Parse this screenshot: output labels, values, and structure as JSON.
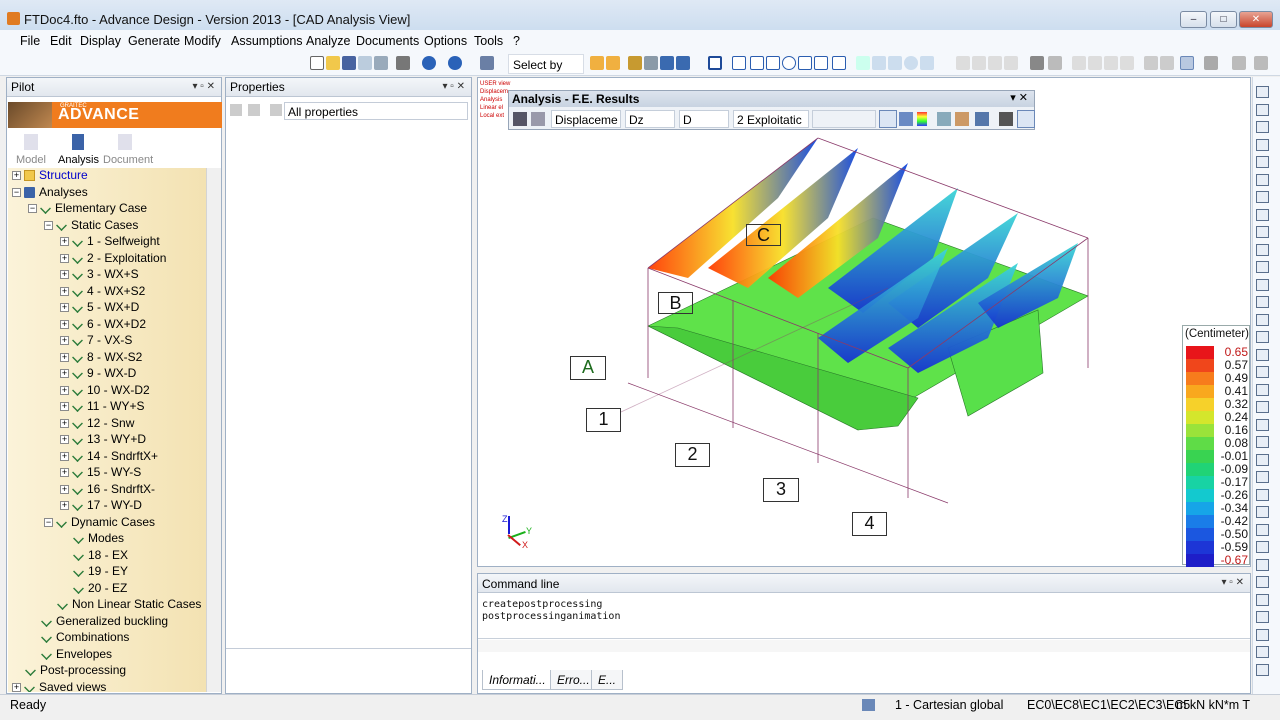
{
  "window": {
    "title": "FTDoc4.fto - Advance Design - Version 2013 - [CAD Analysis View]",
    "minimize": "–",
    "maximize": "□",
    "close": "✕"
  },
  "menu": [
    "File",
    "Edit",
    "Display",
    "Generate",
    "Modify",
    "Assumptions",
    "Analyze",
    "Documents",
    "Options",
    "Tools",
    "?"
  ],
  "toolbar": {
    "select_by": "Select by"
  },
  "pilot": {
    "title": "Pilot",
    "logo_small": "GRAITEC",
    "logo": "ADVANCE",
    "tabs": [
      "Model",
      "Analysis",
      "Document"
    ],
    "active_tab": "Analysis",
    "tree": [
      {
        "label": "Structure",
        "level": 0,
        "exp": "+",
        "icon": "folder",
        "color": "#0000cc"
      },
      {
        "label": "Analyses",
        "level": 0,
        "exp": "−",
        "icon": "book"
      },
      {
        "label": "Elementary Case",
        "level": 1,
        "exp": "−",
        "icon": "check"
      },
      {
        "label": "Static Cases",
        "level": 2,
        "exp": "−",
        "icon": "check"
      },
      {
        "label": "1 - Selfweight",
        "level": 3,
        "exp": "+",
        "icon": "check"
      },
      {
        "label": "2 - Exploitation",
        "level": 3,
        "exp": "+",
        "icon": "check"
      },
      {
        "label": "3 - WX+S",
        "level": 3,
        "exp": "+",
        "icon": "check"
      },
      {
        "label": "4 - WX+S2",
        "level": 3,
        "exp": "+",
        "icon": "check"
      },
      {
        "label": "5 - WX+D",
        "level": 3,
        "exp": "+",
        "icon": "check"
      },
      {
        "label": "6 - WX+D2",
        "level": 3,
        "exp": "+",
        "icon": "check"
      },
      {
        "label": "7 - VX-S",
        "level": 3,
        "exp": "+",
        "icon": "check"
      },
      {
        "label": "8 - WX-S2",
        "level": 3,
        "exp": "+",
        "icon": "check"
      },
      {
        "label": "9 - WX-D",
        "level": 3,
        "exp": "+",
        "icon": "check"
      },
      {
        "label": "10 - WX-D2",
        "level": 3,
        "exp": "+",
        "icon": "check"
      },
      {
        "label": "11 - WY+S",
        "level": 3,
        "exp": "+",
        "icon": "check"
      },
      {
        "label": "12 - Snw",
        "level": 3,
        "exp": "+",
        "icon": "check"
      },
      {
        "label": "13 - WY+D",
        "level": 3,
        "exp": "+",
        "icon": "check"
      },
      {
        "label": "14 - SndrftX+",
        "level": 3,
        "exp": "+",
        "icon": "check"
      },
      {
        "label": "15 - WY-S",
        "level": 3,
        "exp": "+",
        "icon": "check"
      },
      {
        "label": "16 -  SndrftX-",
        "level": 3,
        "exp": "+",
        "icon": "check"
      },
      {
        "label": "17 - WY-D",
        "level": 3,
        "exp": "+",
        "icon": "check"
      },
      {
        "label": "Dynamic Cases",
        "level": 2,
        "exp": "−",
        "icon": "check"
      },
      {
        "label": "Modes",
        "level": 3,
        "exp": "",
        "icon": "check"
      },
      {
        "label": "18 - EX",
        "level": 3,
        "exp": "",
        "icon": "check"
      },
      {
        "label": "19 - EY",
        "level": 3,
        "exp": "",
        "icon": "check"
      },
      {
        "label": "20 - EZ",
        "level": 3,
        "exp": "",
        "icon": "check"
      },
      {
        "label": "Non Linear Static Cases",
        "level": 2,
        "exp": "",
        "icon": "check"
      },
      {
        "label": "Generalized buckling",
        "level": 1,
        "exp": "",
        "icon": "check"
      },
      {
        "label": "Combinations",
        "level": 1,
        "exp": "",
        "icon": "check"
      },
      {
        "label": "Envelopes",
        "level": 1,
        "exp": "",
        "icon": "check"
      },
      {
        "label": "Post-processing",
        "level": 0,
        "exp": "",
        "icon": "check"
      },
      {
        "label": "Saved views",
        "level": 0,
        "exp": "+",
        "icon": "check"
      }
    ]
  },
  "properties": {
    "title": "Properties",
    "filter": "All properties"
  },
  "fe_results": {
    "title": "Analysis - F.E. Results",
    "combos": [
      "Displaceme",
      "Dz",
      "D",
      "2 Exploitatic",
      ""
    ]
  },
  "view": {
    "overlay_lines": [
      "USER view",
      "Displacem",
      "Analysis",
      "Linear el",
      "Local ext"
    ],
    "grid_labels": [
      "A",
      "B",
      "C",
      "1",
      "2",
      "3",
      "4"
    ],
    "axes": {
      "z": "Z",
      "y": "Y",
      "x": "X"
    }
  },
  "legend": {
    "unit": "(Centimeter)",
    "values": [
      "0.65",
      "0.57",
      "0.49",
      "0.41",
      "0.32",
      "0.24",
      "0.16",
      "0.08",
      "-0.01",
      "-0.09",
      "-0.17",
      "-0.26",
      "-0.34",
      "-0.42",
      "-0.50",
      "-0.59",
      "-0.67"
    ],
    "colors": [
      "#e8151a",
      "#f0461b",
      "#f77c1c",
      "#f9a81e",
      "#f6d12a",
      "#d4e62c",
      "#9ae33a",
      "#5fdc47",
      "#39d351",
      "#20d376",
      "#18d3a4",
      "#13c9cf",
      "#16a5e8",
      "#1a7de8",
      "#1b57e0",
      "#1d36d6",
      "#1e1ec8"
    ]
  },
  "command_line": {
    "title": "Command line",
    "lines": [
      "createpostprocessing",
      "postprocessinganimation"
    ],
    "tabs": [
      "Informati...",
      "Erro...",
      "E..."
    ]
  },
  "status": {
    "ready": "Ready",
    "coord_system": "1 - Cartesian global",
    "codes": "EC0\\EC8\\EC1\\EC2\\EC3\\EC5",
    "units": "m  kN  kN*m  T"
  }
}
